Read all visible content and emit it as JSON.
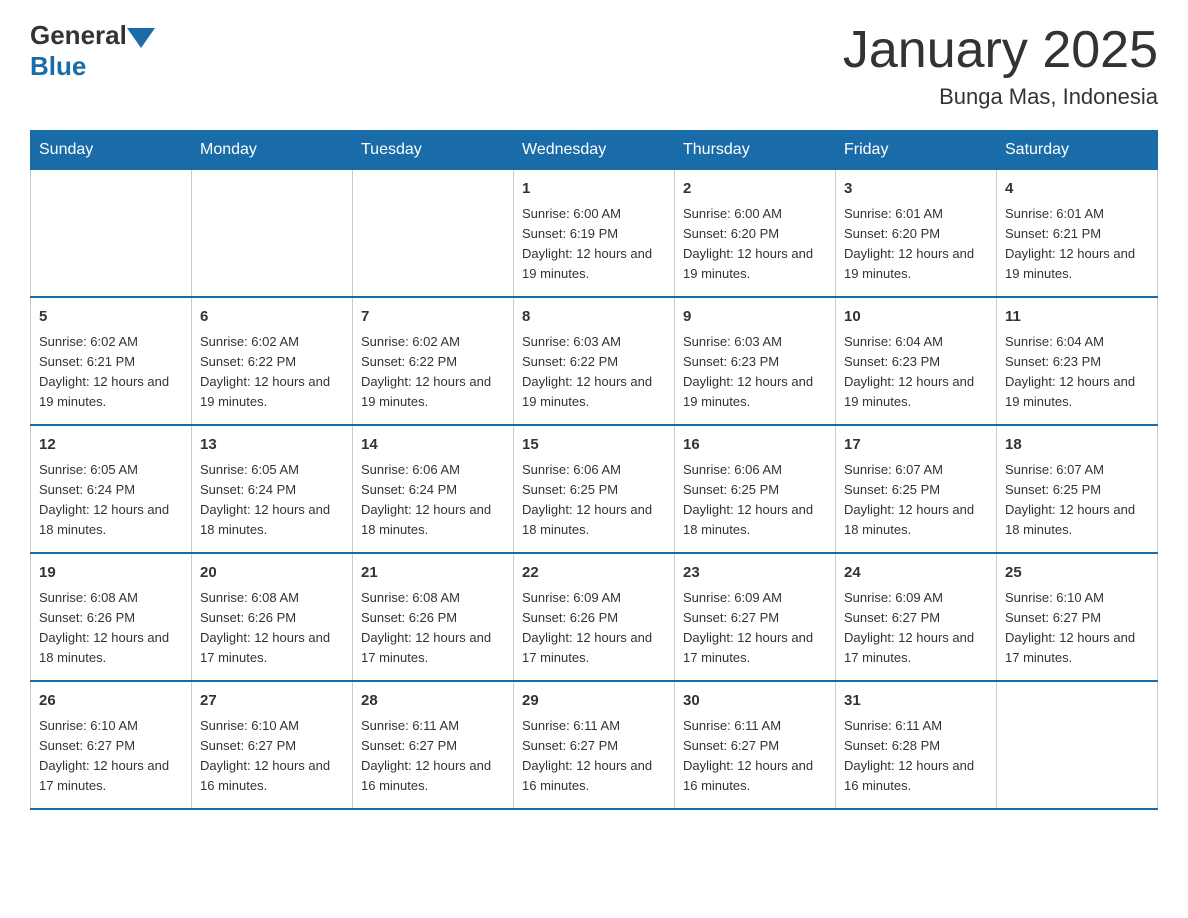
{
  "header": {
    "logo": {
      "general": "General",
      "blue": "Blue"
    },
    "title": "January 2025",
    "subtitle": "Bunga Mas, Indonesia"
  },
  "days_of_week": [
    "Sunday",
    "Monday",
    "Tuesday",
    "Wednesday",
    "Thursday",
    "Friday",
    "Saturday"
  ],
  "weeks": [
    {
      "days": [
        {
          "number": "",
          "info": ""
        },
        {
          "number": "",
          "info": ""
        },
        {
          "number": "",
          "info": ""
        },
        {
          "number": "1",
          "info": "Sunrise: 6:00 AM\nSunset: 6:19 PM\nDaylight: 12 hours\nand 19 minutes."
        },
        {
          "number": "2",
          "info": "Sunrise: 6:00 AM\nSunset: 6:20 PM\nDaylight: 12 hours\nand 19 minutes."
        },
        {
          "number": "3",
          "info": "Sunrise: 6:01 AM\nSunset: 6:20 PM\nDaylight: 12 hours\nand 19 minutes."
        },
        {
          "number": "4",
          "info": "Sunrise: 6:01 AM\nSunset: 6:21 PM\nDaylight: 12 hours\nand 19 minutes."
        }
      ]
    },
    {
      "days": [
        {
          "number": "5",
          "info": "Sunrise: 6:02 AM\nSunset: 6:21 PM\nDaylight: 12 hours\nand 19 minutes."
        },
        {
          "number": "6",
          "info": "Sunrise: 6:02 AM\nSunset: 6:22 PM\nDaylight: 12 hours\nand 19 minutes."
        },
        {
          "number": "7",
          "info": "Sunrise: 6:02 AM\nSunset: 6:22 PM\nDaylight: 12 hours\nand 19 minutes."
        },
        {
          "number": "8",
          "info": "Sunrise: 6:03 AM\nSunset: 6:22 PM\nDaylight: 12 hours\nand 19 minutes."
        },
        {
          "number": "9",
          "info": "Sunrise: 6:03 AM\nSunset: 6:23 PM\nDaylight: 12 hours\nand 19 minutes."
        },
        {
          "number": "10",
          "info": "Sunrise: 6:04 AM\nSunset: 6:23 PM\nDaylight: 12 hours\nand 19 minutes."
        },
        {
          "number": "11",
          "info": "Sunrise: 6:04 AM\nSunset: 6:23 PM\nDaylight: 12 hours\nand 19 minutes."
        }
      ]
    },
    {
      "days": [
        {
          "number": "12",
          "info": "Sunrise: 6:05 AM\nSunset: 6:24 PM\nDaylight: 12 hours\nand 18 minutes."
        },
        {
          "number": "13",
          "info": "Sunrise: 6:05 AM\nSunset: 6:24 PM\nDaylight: 12 hours\nand 18 minutes."
        },
        {
          "number": "14",
          "info": "Sunrise: 6:06 AM\nSunset: 6:24 PM\nDaylight: 12 hours\nand 18 minutes."
        },
        {
          "number": "15",
          "info": "Sunrise: 6:06 AM\nSunset: 6:25 PM\nDaylight: 12 hours\nand 18 minutes."
        },
        {
          "number": "16",
          "info": "Sunrise: 6:06 AM\nSunset: 6:25 PM\nDaylight: 12 hours\nand 18 minutes."
        },
        {
          "number": "17",
          "info": "Sunrise: 6:07 AM\nSunset: 6:25 PM\nDaylight: 12 hours\nand 18 minutes."
        },
        {
          "number": "18",
          "info": "Sunrise: 6:07 AM\nSunset: 6:25 PM\nDaylight: 12 hours\nand 18 minutes."
        }
      ]
    },
    {
      "days": [
        {
          "number": "19",
          "info": "Sunrise: 6:08 AM\nSunset: 6:26 PM\nDaylight: 12 hours\nand 18 minutes."
        },
        {
          "number": "20",
          "info": "Sunrise: 6:08 AM\nSunset: 6:26 PM\nDaylight: 12 hours\nand 17 minutes."
        },
        {
          "number": "21",
          "info": "Sunrise: 6:08 AM\nSunset: 6:26 PM\nDaylight: 12 hours\nand 17 minutes."
        },
        {
          "number": "22",
          "info": "Sunrise: 6:09 AM\nSunset: 6:26 PM\nDaylight: 12 hours\nand 17 minutes."
        },
        {
          "number": "23",
          "info": "Sunrise: 6:09 AM\nSunset: 6:27 PM\nDaylight: 12 hours\nand 17 minutes."
        },
        {
          "number": "24",
          "info": "Sunrise: 6:09 AM\nSunset: 6:27 PM\nDaylight: 12 hours\nand 17 minutes."
        },
        {
          "number": "25",
          "info": "Sunrise: 6:10 AM\nSunset: 6:27 PM\nDaylight: 12 hours\nand 17 minutes."
        }
      ]
    },
    {
      "days": [
        {
          "number": "26",
          "info": "Sunrise: 6:10 AM\nSunset: 6:27 PM\nDaylight: 12 hours\nand 17 minutes."
        },
        {
          "number": "27",
          "info": "Sunrise: 6:10 AM\nSunset: 6:27 PM\nDaylight: 12 hours\nand 16 minutes."
        },
        {
          "number": "28",
          "info": "Sunrise: 6:11 AM\nSunset: 6:27 PM\nDaylight: 12 hours\nand 16 minutes."
        },
        {
          "number": "29",
          "info": "Sunrise: 6:11 AM\nSunset: 6:27 PM\nDaylight: 12 hours\nand 16 minutes."
        },
        {
          "number": "30",
          "info": "Sunrise: 6:11 AM\nSunset: 6:27 PM\nDaylight: 12 hours\nand 16 minutes."
        },
        {
          "number": "31",
          "info": "Sunrise: 6:11 AM\nSunset: 6:28 PM\nDaylight: 12 hours\nand 16 minutes."
        },
        {
          "number": "",
          "info": ""
        }
      ]
    }
  ]
}
